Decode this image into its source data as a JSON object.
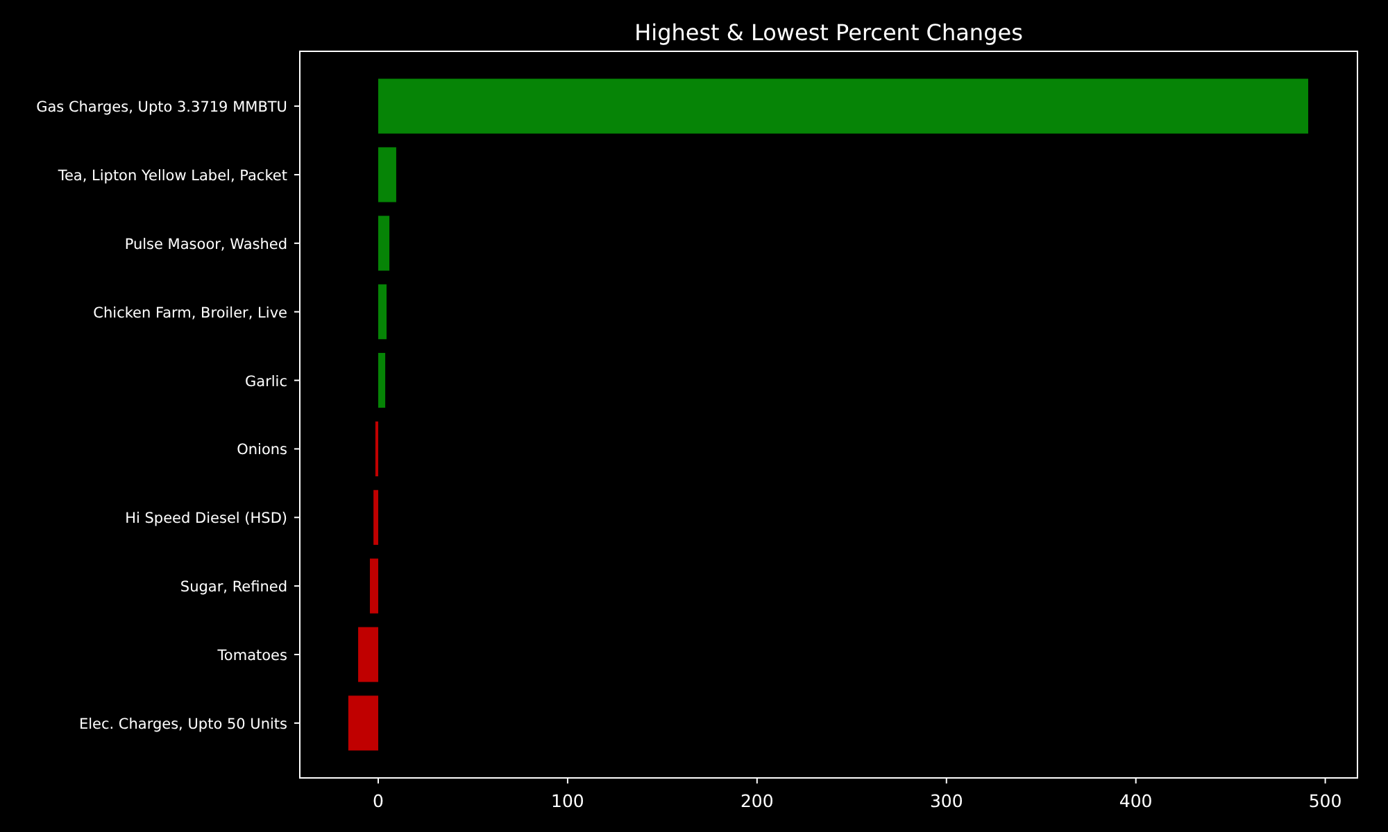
{
  "chart_data": {
    "type": "bar",
    "orientation": "horizontal",
    "title": "Highest & Lowest Percent Changes",
    "categories": [
      "Gas Charges, Upto 3.3719 MMBTU",
      "Tea, Lipton Yellow Label, Packet",
      "Pulse Masoor, Washed",
      "Chicken Farm, Broiler, Live",
      "Garlic",
      "Onions",
      "Hi Speed Diesel (HSD)",
      "Sugar, Refined",
      "Tomatoes",
      "Elec. Charges, Upto 50 Units"
    ],
    "series": [
      {
        "color": "#068406",
        "values": [
          491,
          9.5,
          5.9,
          4.4,
          3.7,
          null,
          null,
          null,
          null,
          null
        ]
      },
      {
        "color": "#c00000",
        "values": [
          null,
          null,
          null,
          null,
          null,
          -1.5,
          -2.5,
          -4.4,
          -10.6,
          -15.8
        ]
      }
    ],
    "xlim": [
      -41.4,
      517
    ],
    "xticks": [
      0,
      100,
      200,
      300,
      400,
      500
    ]
  }
}
